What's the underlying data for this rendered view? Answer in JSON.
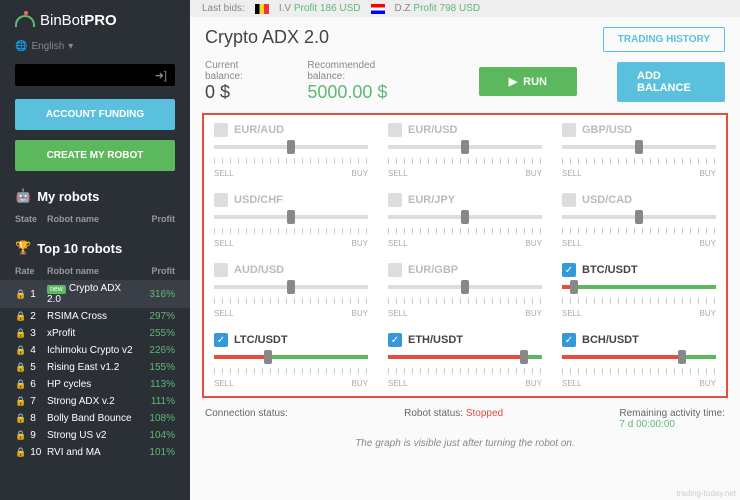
{
  "brand": {
    "name1": "BinBot",
    "name2": "PRO"
  },
  "language": "English",
  "sidebar": {
    "btn_funding": "ACCOUNT FUNDING",
    "btn_create": "CREATE MY ROBOT",
    "myrobots_title": "My robots",
    "myrobots_headers": {
      "state": "State",
      "name": "Robot name",
      "profit": "Profit"
    },
    "top_title": "Top 10 robots",
    "top_headers": {
      "rate": "Rate",
      "name": "Robot name",
      "profit": "Profit"
    },
    "robots": [
      {
        "rank": "1",
        "name": "Crypto ADX 2.0",
        "profit": "316%",
        "new": true
      },
      {
        "rank": "2",
        "name": "RSIMA Cross",
        "profit": "297%"
      },
      {
        "rank": "3",
        "name": "xProfit",
        "profit": "255%"
      },
      {
        "rank": "4",
        "name": "Ichimoku Crypto v2",
        "profit": "226%"
      },
      {
        "rank": "5",
        "name": "Rising East v1.2",
        "profit": "155%"
      },
      {
        "rank": "6",
        "name": "HP cycles",
        "profit": "113%"
      },
      {
        "rank": "7",
        "name": "Strong ADX v.2",
        "profit": "111%"
      },
      {
        "rank": "8",
        "name": "Bolly Band Bounce",
        "profit": "108%"
      },
      {
        "rank": "9",
        "name": "Strong US v2",
        "profit": "104%"
      },
      {
        "rank": "10",
        "name": "RVI and MA",
        "profit": "101%"
      }
    ]
  },
  "topbar": {
    "label": "Last bids:",
    "bid1": {
      "user": "I.V",
      "text": "Profit 186 USD"
    },
    "bid2": {
      "user": "D.Z",
      "text": "Profit 798 USD"
    }
  },
  "header": {
    "title": "Crypto ADX 2.0",
    "history_btn": "TRADING HISTORY"
  },
  "balances": {
    "current_label": "Current balance:",
    "current_value": "0 $",
    "rec_label": "Recommended balance:",
    "rec_value": "5000.00 $",
    "run_btn": "RUN",
    "add_btn": "ADD BALANCE"
  },
  "slider_labels": {
    "sell": "SELL",
    "buy": "BUY"
  },
  "pairs": [
    {
      "name": "EUR/AUD",
      "on": false,
      "pos": 50
    },
    {
      "name": "EUR/USD",
      "on": false,
      "pos": 50
    },
    {
      "name": "GBP/USD",
      "on": false,
      "pos": 50
    },
    {
      "name": "USD/CHF",
      "on": false,
      "pos": 50
    },
    {
      "name": "EUR/JPY",
      "on": false,
      "pos": 50
    },
    {
      "name": "USD/CAD",
      "on": false,
      "pos": 50
    },
    {
      "name": "AUD/USD",
      "on": false,
      "pos": 50
    },
    {
      "name": "EUR/GBP",
      "on": false,
      "pos": 50
    },
    {
      "name": "BTC/USDT",
      "on": true,
      "pos": 8
    },
    {
      "name": "LTC/USDT",
      "on": true,
      "pos": 35
    },
    {
      "name": "ETH/USDT",
      "on": true,
      "pos": 88
    },
    {
      "name": "BCH/USDT",
      "on": true,
      "pos": 78
    }
  ],
  "status": {
    "conn_label": "Connection status:",
    "robot_label": "Robot status:",
    "robot_value": "Stopped",
    "time_label": "Remaining activity time:",
    "time_value": "7 d 00:00:00"
  },
  "graph_note": "The graph is visible just after turning the robot on.",
  "watermark": "trading-today.net"
}
